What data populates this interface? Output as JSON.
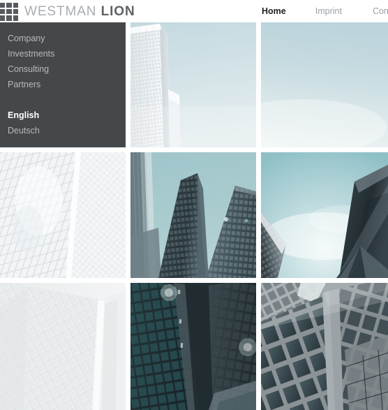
{
  "header": {
    "logo_icon": "nine-square-grid-icon",
    "brand_primary": "WESTMAN",
    "brand_secondary": "LION",
    "nav": [
      {
        "label": "Home",
        "active": true
      },
      {
        "label": "Imprint",
        "active": false
      },
      {
        "label": "Contact",
        "active": false
      }
    ]
  },
  "sidebar": {
    "items": [
      {
        "label": "Company",
        "active": false
      },
      {
        "label": "Investments",
        "active": false
      },
      {
        "label": "Consulting",
        "active": false
      },
      {
        "label": "Partners",
        "active": false
      }
    ],
    "languages": [
      {
        "label": "English",
        "active": true
      },
      {
        "label": "Deutsch",
        "active": false
      }
    ]
  },
  "gallery": {
    "tiles": [
      {
        "position": "row1-col2",
        "alt": "pale-skyscraper-against-light-blue-sky"
      },
      {
        "position": "row1-col3",
        "alt": "plain-pale-blue-sky"
      },
      {
        "position": "row2-col1",
        "alt": "white-glass-facade-diagonal-mullions"
      },
      {
        "position": "row2-col2",
        "alt": "dark-towers-against-teal-sky"
      },
      {
        "position": "row2-col3",
        "alt": "teal-sky-between-dark-building-wedges"
      },
      {
        "position": "row3-col1",
        "alt": "pale-gray-office-facade"
      },
      {
        "position": "row3-col2",
        "alt": "dark-teal-glass-tower-facade"
      },
      {
        "position": "row3-col3",
        "alt": "gray-concrete-framed-windows"
      }
    ]
  },
  "colors": {
    "sidebar_bg": "#45484a",
    "logo_square": "#565a5d",
    "brand_light": "#a9adb1",
    "brand_dark": "#5e6265",
    "nav_inactive": "#9aa0a6",
    "nav_active": "#1e1e1e",
    "sidebar_text": "#b6babd",
    "sidebar_active_text": "#ffffff",
    "sky_teal": "#a8cdd2",
    "sky_pale": "#cfdde2",
    "building_dark": "#2b3336"
  }
}
